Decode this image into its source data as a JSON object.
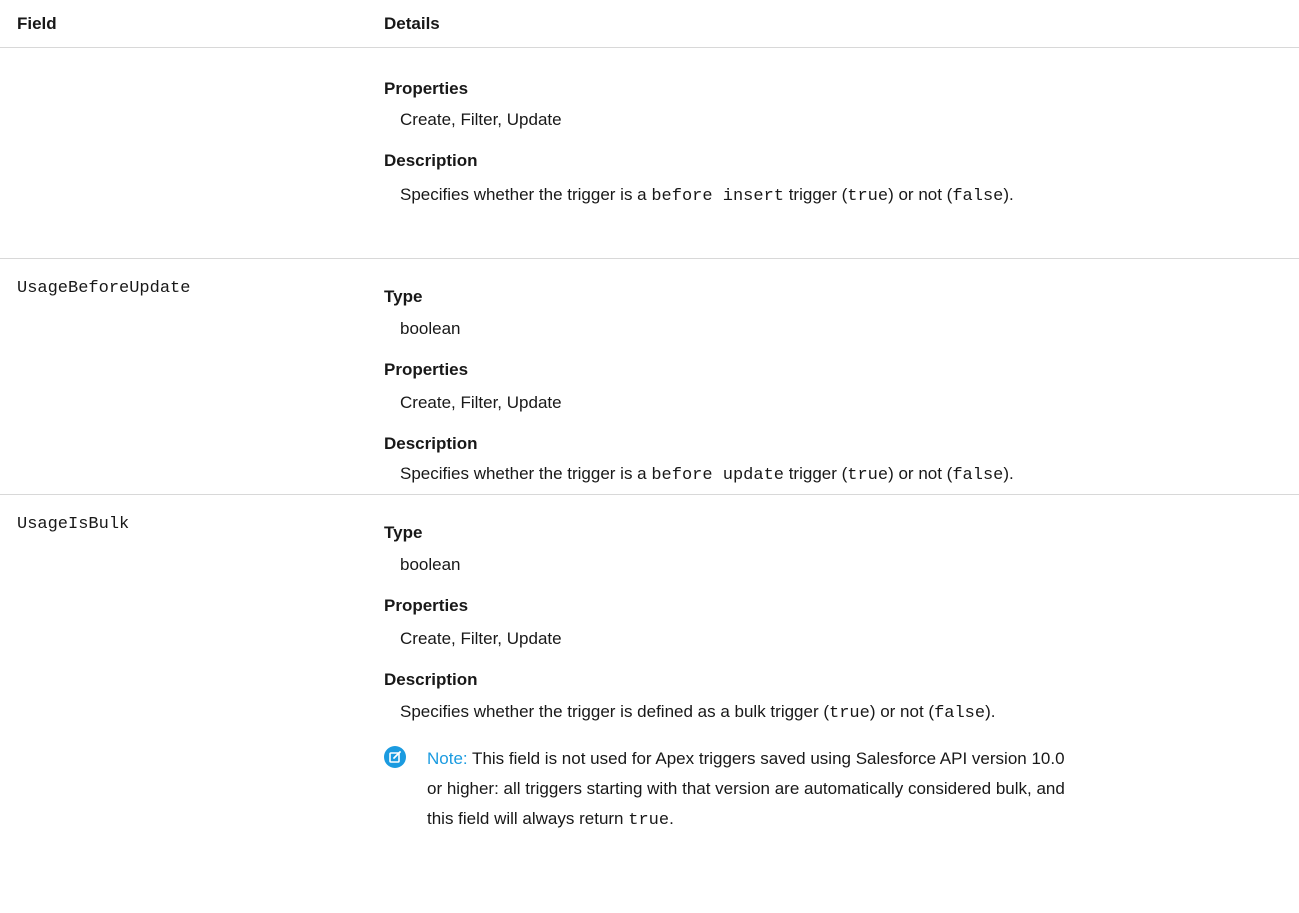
{
  "header": {
    "field": "Field",
    "details": "Details"
  },
  "rows": [
    {
      "field": "",
      "properties_label": "Properties",
      "properties_value": "Create, Filter, Update",
      "description_label": "Description",
      "description": {
        "pre": "Specifies whether the trigger is a ",
        "code1": "before insert",
        "mid1": " trigger (",
        "code2": "true",
        "mid2": ") or not (",
        "code3": "false",
        "post": ")."
      }
    },
    {
      "field": "UsageBeforeUpdate",
      "type_label": "Type",
      "type_value": "boolean",
      "properties_label": "Properties",
      "properties_value": "Create, Filter, Update",
      "description_label": "Description",
      "description": {
        "pre": "Specifies whether the trigger is a ",
        "code1": "before update",
        "mid1": " trigger (",
        "code2": "true",
        "mid2": ") or not (",
        "code3": "false",
        "post": ")."
      }
    },
    {
      "field": "UsageIsBulk",
      "type_label": "Type",
      "type_value": "boolean",
      "properties_label": "Properties",
      "properties_value": "Create, Filter, Update",
      "description_label": "Description",
      "description": {
        "pre": "Specifies whether the trigger is defined as a bulk trigger (",
        "code1": "true",
        "mid1": ") or not (",
        "code2": "false",
        "post": ")."
      },
      "note": {
        "label": "Note:",
        "line1": " This field is not used for Apex triggers saved using Salesforce API version 10.0",
        "line2": "or higher: all triggers starting with that version are automatically considered bulk, and",
        "line3_pre": "this field will always return ",
        "line3_code": "true",
        "line3_post": "."
      }
    }
  ],
  "colors": {
    "accent": "#1b9be0",
    "text": "#181818",
    "divider": "#d8d8d8"
  },
  "icons": {
    "note": "edit-note-icon"
  }
}
